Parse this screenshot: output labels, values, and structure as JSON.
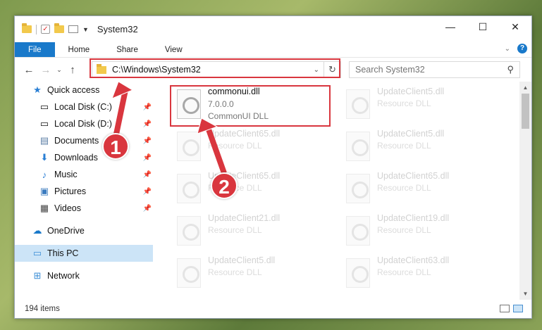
{
  "window": {
    "title": "System32",
    "controls": {
      "minimize": "—",
      "maximize": "☐",
      "close": "✕"
    }
  },
  "ribbon": {
    "tabs": [
      {
        "label": "File"
      },
      {
        "label": "Home"
      },
      {
        "label": "Share"
      },
      {
        "label": "View"
      }
    ],
    "help": "?"
  },
  "address": {
    "path": "C:\\Windows\\System32",
    "search_placeholder": "Search System32"
  },
  "sidebar": {
    "items": [
      {
        "label": "Quick access",
        "icon": "star-icon"
      },
      {
        "label": "Local Disk (C:)",
        "icon": "drive-icon"
      },
      {
        "label": "Local Disk (D:)",
        "icon": "drive-icon"
      },
      {
        "label": "Documents",
        "icon": "documents-icon"
      },
      {
        "label": "Downloads",
        "icon": "downloads-icon"
      },
      {
        "label": "Music",
        "icon": "music-icon"
      },
      {
        "label": "Pictures",
        "icon": "pictures-icon"
      },
      {
        "label": "Videos",
        "icon": "videos-icon"
      },
      {
        "label": "OneDrive",
        "icon": "cloud-icon"
      },
      {
        "label": "This PC",
        "icon": "computer-icon"
      },
      {
        "label": "Network",
        "icon": "network-icon"
      }
    ]
  },
  "files": [
    {
      "name": "commonui.dll",
      "version": "7.0.0.0",
      "desc": "CommonUI DLL"
    },
    {
      "name": "UpdateClient5.dll",
      "desc": "Resource DLL"
    },
    {
      "name": "UpdateClient65.dll",
      "desc": "Resource DLL"
    },
    {
      "name": "UpdateClient5.dll",
      "desc": "Resource DLL"
    },
    {
      "name": "UpdateClient65.dll",
      "desc": "Resource DLL"
    },
    {
      "name": "UpdateClient65.dll",
      "desc": "Resource DLL"
    },
    {
      "name": "UpdateClient21.dll",
      "desc": "Resource DLL"
    },
    {
      "name": "UpdateClient19.dll",
      "desc": "Resource DLL"
    },
    {
      "name": "UpdateClient5.dll",
      "desc": "Resource DLL"
    },
    {
      "name": "UpdateClient63.dll",
      "desc": "Resource DLL"
    }
  ],
  "status": {
    "count": "194 items"
  },
  "annotations": {
    "step1": "1",
    "step2": "2"
  },
  "colors": {
    "highlight": "#d9363e",
    "accent": "#1979ca",
    "selected": "#cce4f7"
  }
}
